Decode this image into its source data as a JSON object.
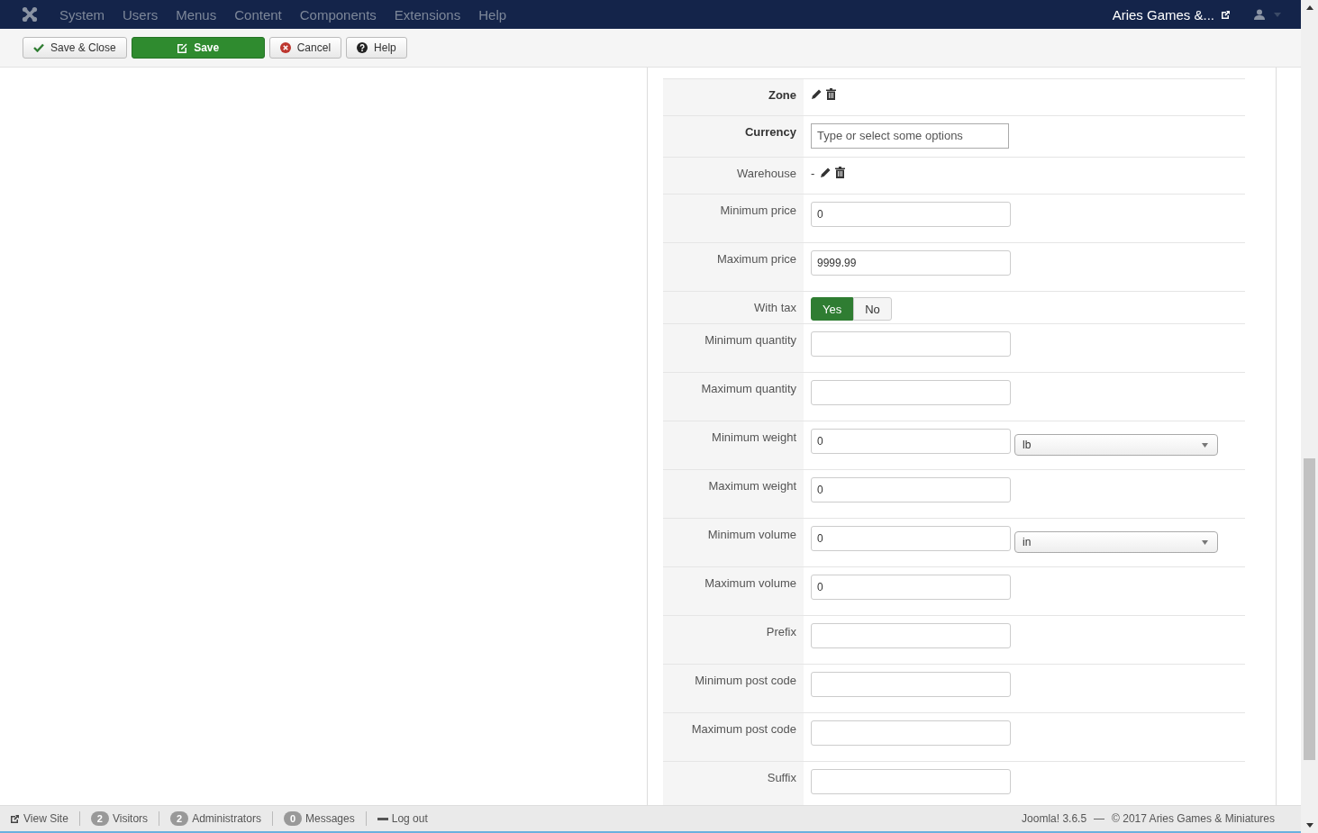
{
  "menu": {
    "items": [
      "System",
      "Users",
      "Menus",
      "Content",
      "Components",
      "Extensions",
      "Help"
    ],
    "site_name": "Aries Games &..."
  },
  "toolbar": [
    {
      "label": "Save & Close",
      "kind": "check",
      "primary": false
    },
    {
      "label": "Save",
      "kind": "edit",
      "primary": true
    },
    {
      "label": "Cancel",
      "kind": "cancel",
      "primary": false
    },
    {
      "label": "Help",
      "kind": "help",
      "primary": false
    }
  ],
  "fields": [
    {
      "label": "Zone",
      "required": true,
      "kind": "icons"
    },
    {
      "label": "Currency",
      "required": true,
      "kind": "tokens",
      "placeholder": "Type or select some options"
    },
    {
      "label": "Warehouse",
      "required": false,
      "kind": "icons",
      "prefix": "-"
    },
    {
      "label": "Minimum price",
      "required": false,
      "kind": "input",
      "value": "0"
    },
    {
      "label": "Maximum price",
      "required": false,
      "kind": "input",
      "value": "9999.99"
    },
    {
      "label": "With tax",
      "required": false,
      "kind": "toggle",
      "options": [
        {
          "label": "Yes",
          "selected": true
        },
        {
          "label": "No",
          "selected": false
        }
      ]
    },
    {
      "label": "Minimum quantity",
      "required": false,
      "kind": "input"
    },
    {
      "label": "Maximum quantity",
      "required": false,
      "kind": "input"
    },
    {
      "label": "Minimum weight",
      "required": false,
      "kind": "input",
      "value": "0",
      "unit": "lb"
    },
    {
      "label": "Maximum weight",
      "required": false,
      "kind": "input",
      "value": "0"
    },
    {
      "label": "Minimum volume",
      "required": false,
      "kind": "input",
      "value": "0",
      "unit": "in"
    },
    {
      "label": "Maximum volume",
      "required": false,
      "kind": "input",
      "value": "0"
    },
    {
      "label": "Prefix",
      "required": false,
      "kind": "input"
    },
    {
      "label": "Minimum post code",
      "required": false,
      "kind": "input"
    },
    {
      "label": "Maximum post code",
      "required": false,
      "kind": "input"
    },
    {
      "label": "Suffix",
      "required": false,
      "kind": "input"
    }
  ],
  "status_bar": {
    "view_site": "View Site",
    "badges": [
      {
        "count": "2",
        "label": "Visitors"
      },
      {
        "count": "2",
        "label": "Administrators"
      },
      {
        "count": "0",
        "label": "Messages"
      }
    ],
    "logout": "Log out",
    "version": "Joomla! 3.6.5",
    "separator": "—",
    "copyright": "© 2017 Aries Games & Miniatures"
  }
}
